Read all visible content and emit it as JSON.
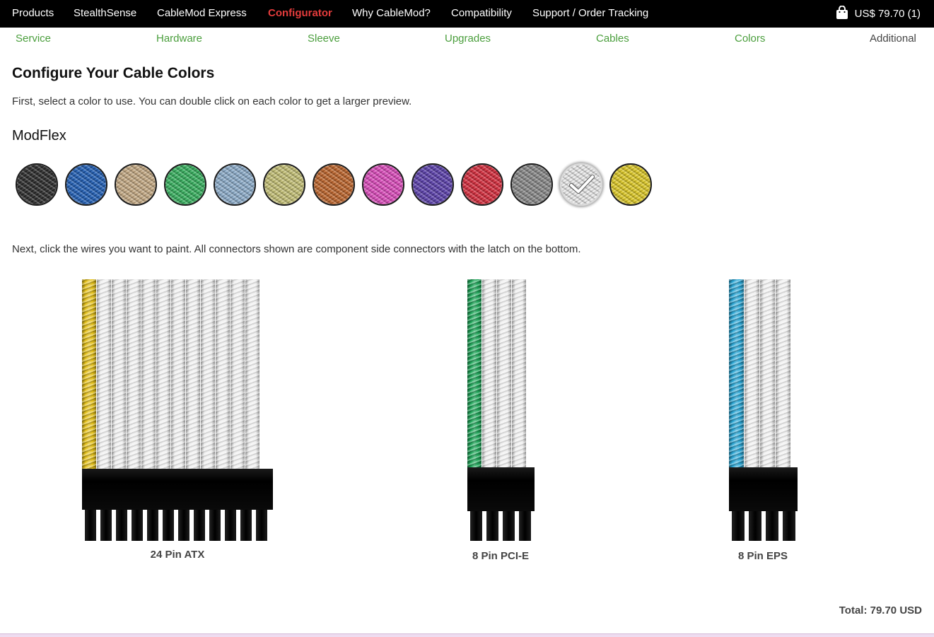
{
  "nav": {
    "items": [
      "Products",
      "StealthSense",
      "CableMod Express",
      "Configurator",
      "Why CableMod?",
      "Compatibility",
      "Support / Order Tracking"
    ],
    "active_index": 3,
    "cart_label": "US$ 79.70 (1)"
  },
  "steps": [
    "Service",
    "Hardware",
    "Sleeve",
    "Upgrades",
    "Cables",
    "Colors",
    "Additional"
  ],
  "page": {
    "title": "Configure Your Cable Colors",
    "intro": "First, select a color to use. You can double click on each color to get a larger preview.",
    "series": "ModFlex",
    "instruction": "Next, click the wires you want to paint. All connectors shown are component side connectors with the latch on the bottom."
  },
  "swatches": [
    {
      "color": "#2a2a2a",
      "selected": false
    },
    {
      "color": "#1f5fb8",
      "selected": false
    },
    {
      "color": "#c9ad86",
      "selected": false
    },
    {
      "color": "#35b35e",
      "selected": false
    },
    {
      "color": "#8fb0cf",
      "selected": false
    },
    {
      "color": "#c8c477",
      "selected": false
    },
    {
      "color": "#c0652a",
      "selected": false
    },
    {
      "color": "#e04bbf",
      "selected": false
    },
    {
      "color": "#5b3fae",
      "selected": false
    },
    {
      "color": "#d92a3b",
      "selected": false
    },
    {
      "color": "#8a8a8a",
      "selected": false
    },
    {
      "color": "#eeeeee",
      "selected": true
    },
    {
      "color": "#e2cd26",
      "selected": false
    }
  ],
  "connectors": [
    {
      "label": "24 Pin ATX",
      "wire_colors": [
        "#e6c21a",
        "#f0f0f0",
        "#f0f0f0",
        "#f0f0f0",
        "#f0f0f0",
        "#f0f0f0",
        "#f0f0f0",
        "#f0f0f0",
        "#f0f0f0",
        "#f0f0f0",
        "#f0f0f0",
        "#f0f0f0"
      ]
    },
    {
      "label": "8 Pin PCI-E",
      "wire_colors": [
        "#1fa85a",
        "#f0f0f0",
        "#f0f0f0",
        "#f0f0f0"
      ]
    },
    {
      "label": "8 Pin EPS",
      "wire_colors": [
        "#2aa7d6",
        "#f0f0f0",
        "#f0f0f0",
        "#f0f0f0"
      ]
    }
  ],
  "total": "Total: 79.70 USD"
}
